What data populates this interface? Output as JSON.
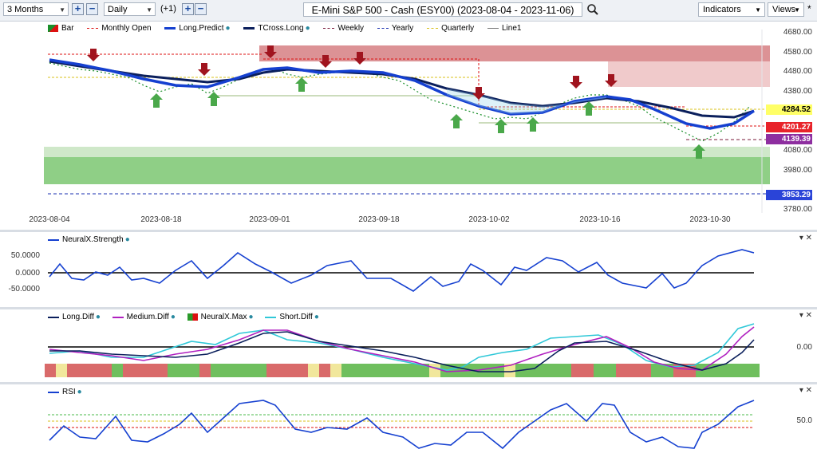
{
  "toolbar": {
    "period": "3 Months",
    "interval": "Daily",
    "offset": "(+1)",
    "title": "E-Mini S&P 500 - Cash (ESY00) (2023-08-04 - 2023-11-06)",
    "indicators_label": "Indicators",
    "views_label": "Views",
    "asterisk": "*"
  },
  "main_legend": [
    {
      "label": "Bar",
      "color": "#1a8f2a",
      "kind": "bar"
    },
    {
      "label": "Monthly Open",
      "color": "#d11",
      "kind": "dash"
    },
    {
      "label": "Long.Predict",
      "color": "#1540d0",
      "kind": "thick"
    },
    {
      "label": "TCross.Long",
      "color": "#0b1f5c",
      "kind": "thick"
    },
    {
      "label": "Weekly",
      "color": "#7a1a3a",
      "kind": "dash"
    },
    {
      "label": "Yearly",
      "color": "#1a2fb0",
      "kind": "dash"
    },
    {
      "label": "Quarterly",
      "color": "#d8c01a",
      "kind": "dash"
    },
    {
      "label": "Line1",
      "color": "#777777",
      "kind": "solid"
    }
  ],
  "price_axis": [
    "4680.00",
    "4580.00",
    "4480.00",
    "4380.00",
    "4284.52",
    "4201.27",
    "4139.39",
    "4080.00",
    "3980.00",
    "3853.29",
    "3780.00"
  ],
  "price_tags": [
    {
      "value": "4284.52",
      "bg": "#ffff66",
      "color": "#000"
    },
    {
      "value": "4201.27",
      "bg": "#e8232a",
      "color": "#fff"
    },
    {
      "value": "4139.39",
      "bg": "#8e2ea0",
      "color": "#fff"
    },
    {
      "value": "3853.29",
      "bg": "#2a44d8",
      "color": "#fff"
    }
  ],
  "dates": [
    "2023-08-04",
    "2023-08-18",
    "2023-09-01",
    "2023-09-18",
    "2023-10-02",
    "2023-10-16",
    "2023-10-30"
  ],
  "strength_pane": {
    "legend": "NeuralX.Strength",
    "axis": [
      "50.0000",
      "0.0000",
      "-50.0000"
    ]
  },
  "diff_pane": {
    "legend": [
      {
        "label": "Long.Diff",
        "color": "#0b1f5c"
      },
      {
        "label": "Medium.Diff",
        "color": "#b020c0"
      },
      {
        "label": "NeuralX.Max",
        "color": "#2a9a2a"
      },
      {
        "label": "Short.Diff",
        "color": "#30c8d8"
      }
    ],
    "axis": [
      "0.00"
    ]
  },
  "rsi_pane": {
    "legend": "RSI",
    "axis": [
      "50.0"
    ]
  },
  "pane_controls": "▾ ✕"
}
